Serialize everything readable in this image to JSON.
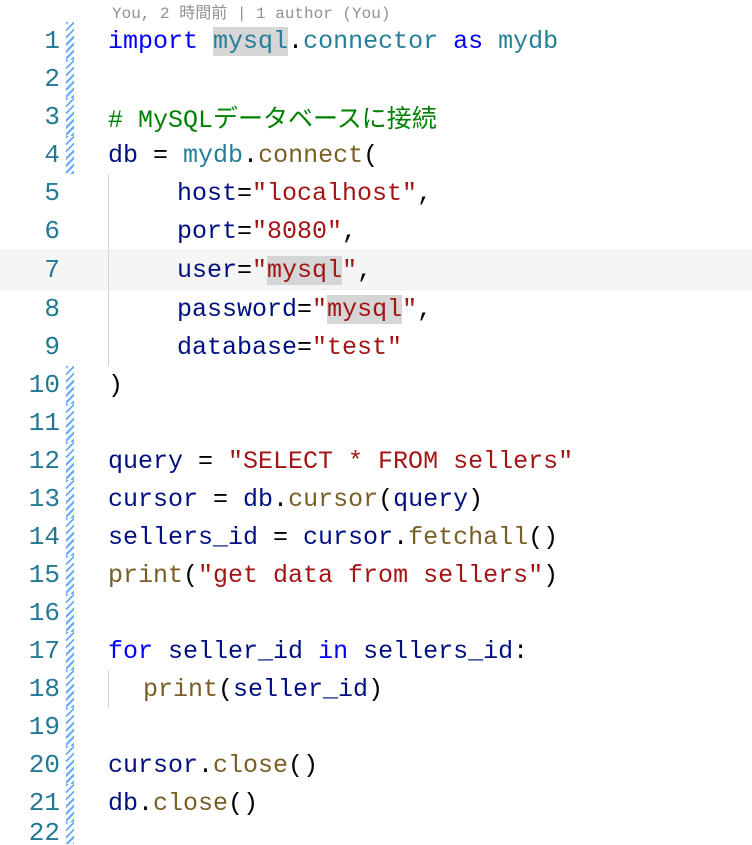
{
  "codelens": "You, 2 時間前 | 1 author (You)",
  "lines": {
    "n1": "1",
    "n2": "2",
    "n3": "3",
    "n4": "4",
    "n5": "5",
    "n6": "6",
    "n7": "7",
    "n8": "8",
    "n9": "9",
    "n10": "10",
    "n11": "11",
    "n12": "12",
    "n13": "13",
    "n14": "14",
    "n15": "15",
    "n16": "16",
    "n17": "17",
    "n18": "18",
    "n19": "19",
    "n20": "20",
    "n21": "21",
    "n22": "22"
  },
  "t": {
    "import": "import ",
    "mysql": "mysql",
    "dot": ".",
    "connector": "connector",
    " as_": " ",
    "as": "as",
    " mydb_": " ",
    "mydb": "mydb",
    "comment": "# MySQLデータベースに接続",
    "db": "db",
    "eq": " = ",
    "connect": "connect",
    "lpar": "(",
    "rpar": ")",
    "comma": ",",
    "host": "host",
    "assign": "=",
    "hostv": "\"localhost\"",
    "port": "port",
    "portv": "\"8080\"",
    "user": "user",
    "userv_open": "\"",
    "userv": "mysql",
    "userv_close": "\"",
    "password": "password",
    "pwv_open": "\"",
    "pwv": "mysql",
    "pwv_close": "\"",
    "database": "database",
    "dbv": "\"test\"",
    "query": "query",
    "queryv": "\"SELECT * FROM sellers\"",
    "cursor": "cursor",
    "cursorfn": "cursor",
    "sellers_id": "sellers_id",
    "fetchall": "fetchall",
    "print": "print",
    "getdata": "\"get data from sellers\"",
    "for": "for ",
    "seller_id": "seller_id",
    " in_": " ",
    "in": "in",
    " sid_": " ",
    "colon": ":",
    "close": "close"
  }
}
